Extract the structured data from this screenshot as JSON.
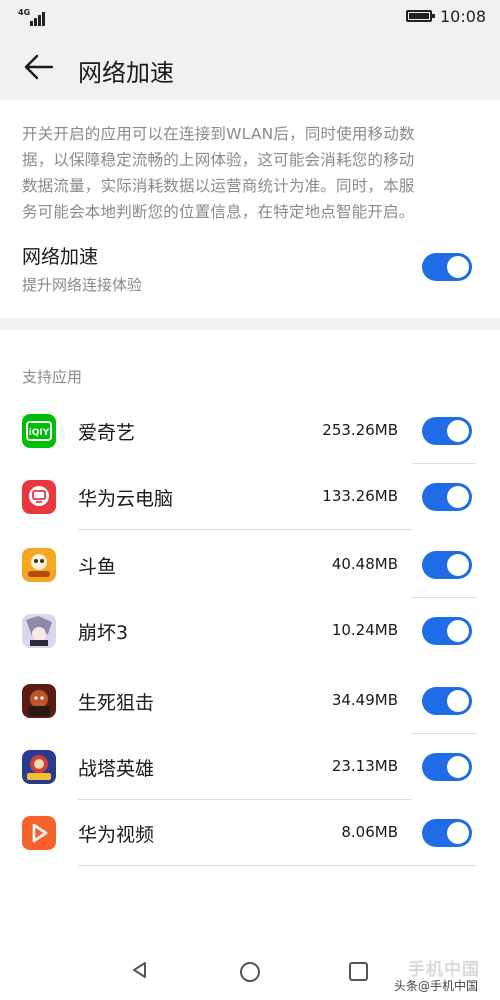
{
  "status_bar": {
    "network": "4G",
    "time": "10:08"
  },
  "header": {
    "title": "网络加速"
  },
  "description": {
    "lines": [
      "开关开启的应用可以在连接到WLAN后，同时使用移动数",
      "据，以保障稳定流畅的上网体验，这可能会消耗您的移动",
      "数据流量，实际消耗数据以运营商统计为准。同时，本服",
      "务可能会本地判断您的位置信息，在特定地点智能开启。"
    ]
  },
  "main_toggle": {
    "title": "网络加速",
    "subtitle": "提升网络连接体验",
    "on": true
  },
  "section": {
    "label": "支持应用"
  },
  "apps": [
    {
      "name": "爱奇艺",
      "size": "253.26MB",
      "on": true,
      "icon": "iqiyi-icon",
      "color": "#00be06"
    },
    {
      "name": "华为云电脑",
      "size": "133.26MB",
      "on": true,
      "icon": "cloud-pc-icon",
      "color": "#e8383d"
    },
    {
      "name": "斗鱼",
      "size": "40.48MB",
      "on": true,
      "icon": "douyu-icon",
      "color": "#f5a623"
    },
    {
      "name": "崩坏3",
      "size": "10.24MB",
      "on": true,
      "icon": "honkai-icon",
      "color": "#c9c3d8"
    },
    {
      "name": "生死狙击",
      "size": "34.49MB",
      "on": true,
      "icon": "sniper-icon",
      "color": "#8a2b1e"
    },
    {
      "name": "战塔英雄",
      "size": "23.13MB",
      "on": true,
      "icon": "tower-hero-icon",
      "color": "#2a3a8f"
    },
    {
      "name": "华为视频",
      "size": "8.06MB",
      "on": true,
      "icon": "huawei-video-icon",
      "color": "#f7622b"
    }
  ],
  "watermark": {
    "brand": "手机中国",
    "credit": "头条@手机中国"
  },
  "colors": {
    "accent": "#1e6de6",
    "header_bg": "#f1f1f1",
    "secondary_text": "#8a8a8a"
  }
}
